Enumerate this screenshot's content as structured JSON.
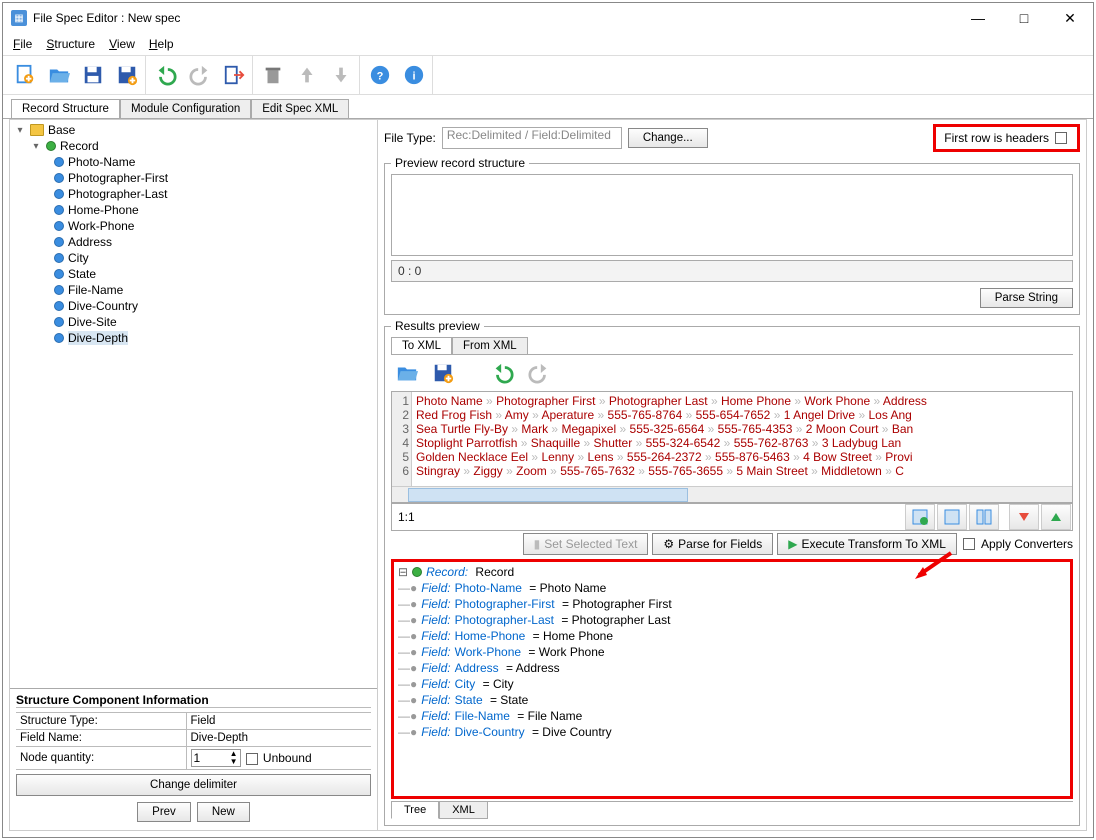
{
  "window": {
    "title": "File Spec Editor : New spec"
  },
  "menu": {
    "file": "File",
    "structure": "Structure",
    "view": "View",
    "help": "Help"
  },
  "maintabs": {
    "t1": "Record Structure",
    "t2": "Module Configuration",
    "t3": "Edit Spec XML"
  },
  "tree": {
    "root": "Base",
    "record": "Record",
    "fields": [
      "Photo-Name",
      "Photographer-First",
      "Photographer-Last",
      "Home-Phone",
      "Work-Phone",
      "Address",
      "City",
      "State",
      "File-Name",
      "Dive-Country",
      "Dive-Site",
      "Dive-Depth"
    ]
  },
  "sci": {
    "title": "Structure Component Information",
    "rows": {
      "r1k": "Structure Type:",
      "r1v": "Field",
      "r2k": "Field Name:",
      "r2v": "Dive-Depth",
      "r3k": "Node quantity:",
      "r3v": "1",
      "unbound": "Unbound"
    },
    "change": "Change delimiter",
    "prev": "Prev",
    "new": "New"
  },
  "right": {
    "filetype_label": "File Type:",
    "filetype_value": "Rec:Delimited / Field:Delimited",
    "change": "Change...",
    "first_row": "First row is headers",
    "preview_legend": "Preview record structure",
    "pos": "0 : 0",
    "parse": "Parse String",
    "results_legend": "Results preview",
    "tab_toxml": "To XML",
    "tab_fromxml": "From XML",
    "midpos": "1:1",
    "set_sel": "Set Selected Text",
    "parse_fields": "Parse for Fields",
    "exec": "Execute Transform To XML",
    "apply": "Apply Converters",
    "bot_tree": "Tree",
    "bot_xml": "XML"
  },
  "code": {
    "lines": [
      [
        "Photo Name",
        "Photographer First",
        "Photographer Last",
        "Home Phone",
        "Work Phone",
        "Address"
      ],
      [
        "Red Frog Fish",
        "Amy",
        "Aperature",
        "555-765-8764",
        "555-654-7652",
        "1 Angel Drive",
        "Los Ang"
      ],
      [
        "Sea Turtle Fly-By",
        "Mark",
        "Megapixel",
        "555-325-6564",
        "555-765-4353",
        "2 Moon Court",
        "Ban"
      ],
      [
        "Stoplight Parrotfish",
        "Shaquille",
        "Shutter",
        "555-324-6542",
        "555-762-8763",
        "3 Ladybug Lan"
      ],
      [
        "Golden Necklace Eel",
        "Lenny",
        "Lens",
        "555-264-2372",
        "555-876-5463",
        "4 Bow Street",
        "Provi"
      ],
      [
        "Stingray",
        "Ziggy",
        "Zoom",
        "555-765-7632",
        "555-765-3655",
        "5 Main Street",
        "Middletown",
        "C"
      ]
    ]
  },
  "fieldtree": {
    "record_kw": "Record:",
    "record": "Record",
    "field_kw": "Field:",
    "rows": [
      {
        "k": "Photo-Name",
        "v": "Photo Name"
      },
      {
        "k": "Photographer-First",
        "v": "Photographer First"
      },
      {
        "k": "Photographer-Last",
        "v": "Photographer Last"
      },
      {
        "k": "Home-Phone",
        "v": "Home Phone"
      },
      {
        "k": "Work-Phone",
        "v": "Work Phone"
      },
      {
        "k": "Address",
        "v": "Address"
      },
      {
        "k": "City",
        "v": "City"
      },
      {
        "k": "State",
        "v": "State"
      },
      {
        "k": "File-Name",
        "v": "File Name"
      },
      {
        "k": "Dive-Country",
        "v": "Dive Country"
      }
    ]
  }
}
